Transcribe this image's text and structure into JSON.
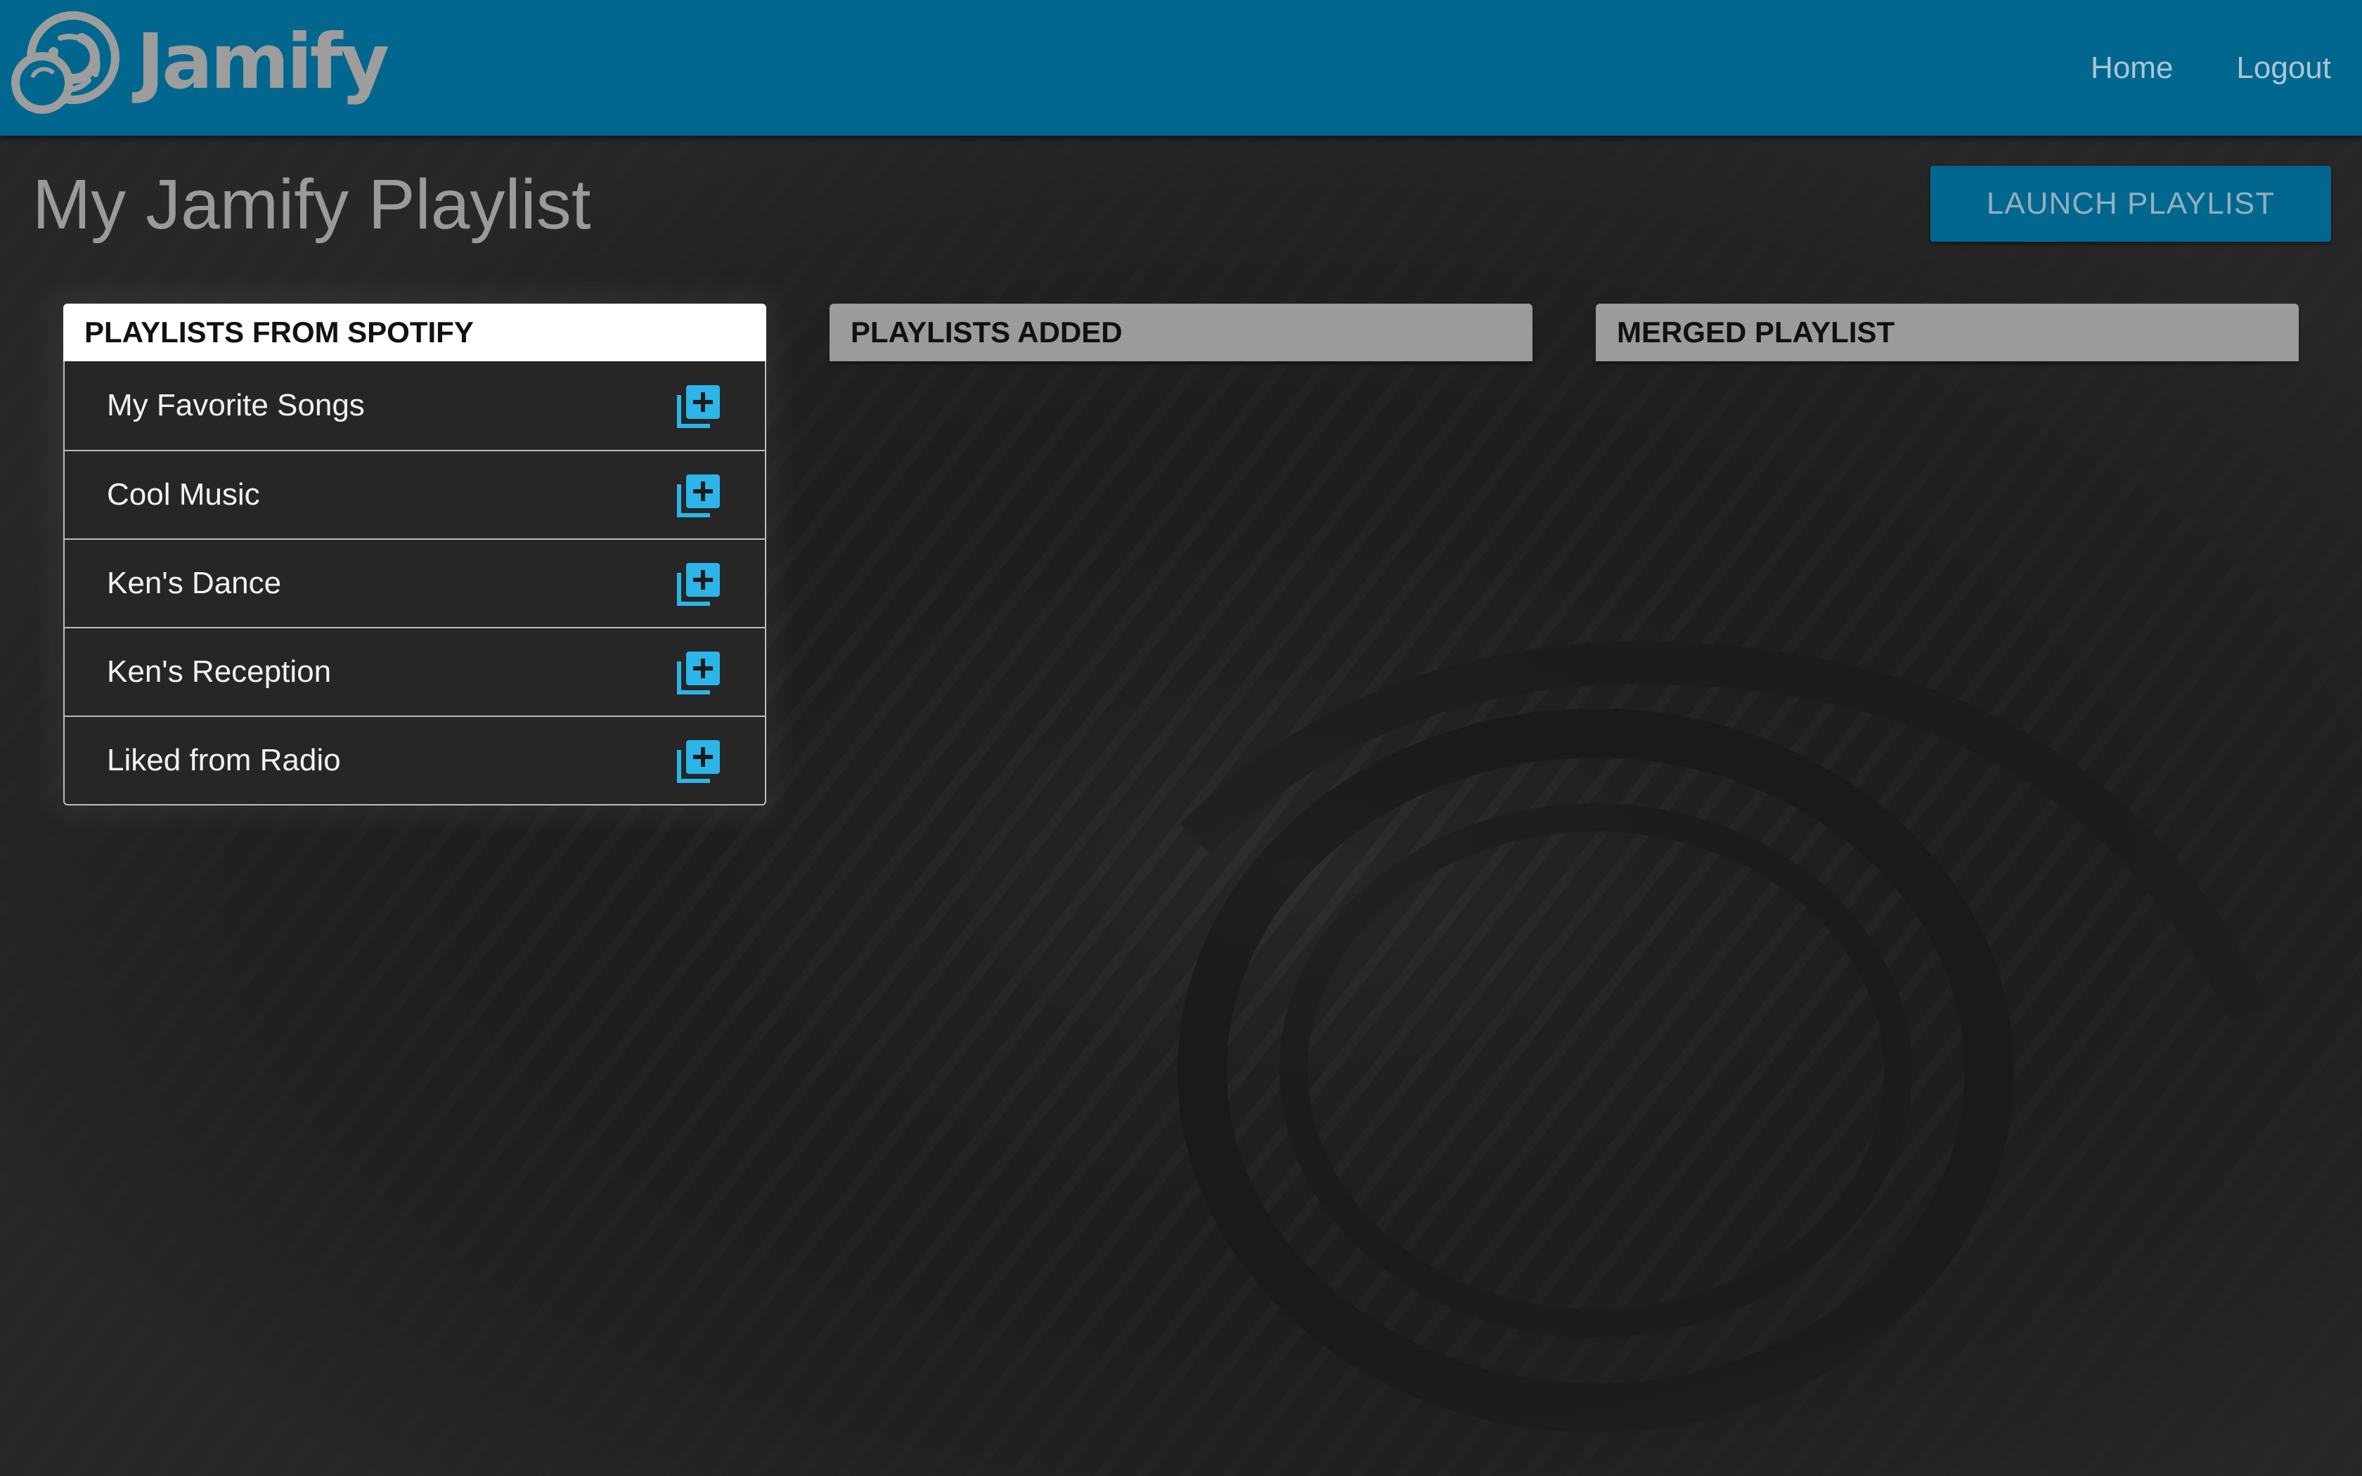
{
  "app": {
    "brand": "Jamify",
    "accent_color": "#01678e",
    "icon_accent_color": "#2cb5e8"
  },
  "header": {
    "nav": {
      "home_label": "Home",
      "logout_label": "Logout"
    }
  },
  "page": {
    "title": "My Jamify Playlist",
    "launch_label": "LAUNCH PLAYLIST"
  },
  "columns": {
    "spotify": {
      "title": "PLAYLISTS FROM SPOTIFY",
      "items": [
        {
          "name": "My Favorite Songs",
          "icon": "add-to-playlist-icon"
        },
        {
          "name": "Cool Music",
          "icon": "add-to-playlist-icon"
        },
        {
          "name": "Ken's Dance",
          "icon": "add-to-playlist-icon"
        },
        {
          "name": "Ken's Reception",
          "icon": "add-to-playlist-icon"
        },
        {
          "name": "Liked from Radio",
          "icon": "add-to-playlist-icon"
        }
      ]
    },
    "added": {
      "title": "PLAYLISTS ADDED",
      "items": []
    },
    "merged": {
      "title": "MERGED PLAYLIST",
      "items": []
    }
  }
}
